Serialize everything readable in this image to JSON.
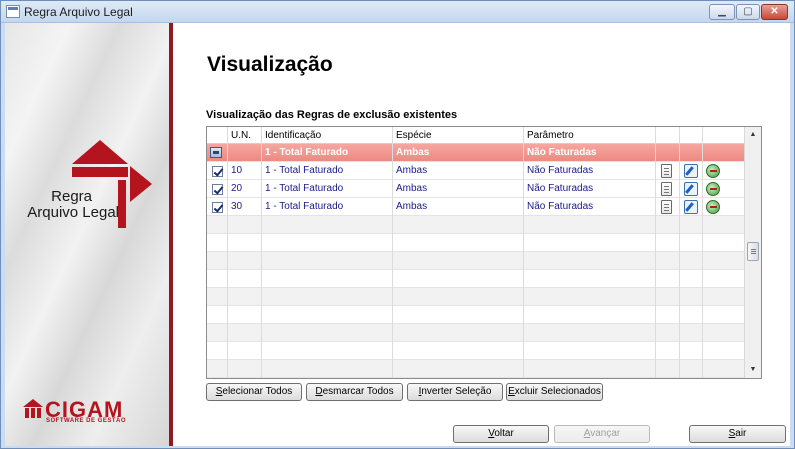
{
  "window": {
    "title": "Regra Arquivo Legal",
    "minimize": "▁",
    "maximize": "▢",
    "close": "✕"
  },
  "side": {
    "logo_line1": "Regra",
    "logo_line2": "Arquivo Legal",
    "brand": "CIGAM",
    "brand_sub": "SOFTWARE DE GESTÃO",
    "accent_color": "#b3141e"
  },
  "main": {
    "title": "Visualização",
    "section_label": "Visualização das Regras de exclusão existentes"
  },
  "grid": {
    "columns": [
      "",
      "U.N.",
      "Identificação",
      "Espécie",
      "Parâmetro"
    ],
    "header_row": {
      "un": "",
      "identificacao": "1 - Total Faturado",
      "especie": "Ambas",
      "parametro": "Não Faturadas"
    },
    "rows": [
      {
        "checked": true,
        "un": "10",
        "identificacao": "1 - Total Faturado",
        "especie": "Ambas",
        "parametro": "Não Faturadas"
      },
      {
        "checked": true,
        "un": "20",
        "identificacao": "1 - Total Faturado",
        "especie": "Ambas",
        "parametro": "Não Faturadas"
      },
      {
        "checked": true,
        "un": "30",
        "identificacao": "1 - Total Faturado",
        "especie": "Ambas",
        "parametro": "Não Faturadas"
      }
    ],
    "row_icons": [
      "document-icon",
      "edit-icon",
      "delete-icon"
    ]
  },
  "buttons": {
    "select_all": {
      "pre": "",
      "key": "S",
      "post": "elecionar Todos"
    },
    "deselect_all": {
      "pre": "",
      "key": "D",
      "post": "esmarcar Todos"
    },
    "invert": {
      "pre": "",
      "key": "I",
      "post": "nverter Seleção"
    },
    "delete_selected": {
      "pre": "",
      "key": "E",
      "post": "xcluir Selecionados"
    },
    "back": {
      "pre": "",
      "key": "V",
      "post": "oltar"
    },
    "next": {
      "pre": "",
      "key": "A",
      "post": "vançar"
    },
    "exit": {
      "pre": "",
      "key": "S",
      "post": "air"
    }
  }
}
